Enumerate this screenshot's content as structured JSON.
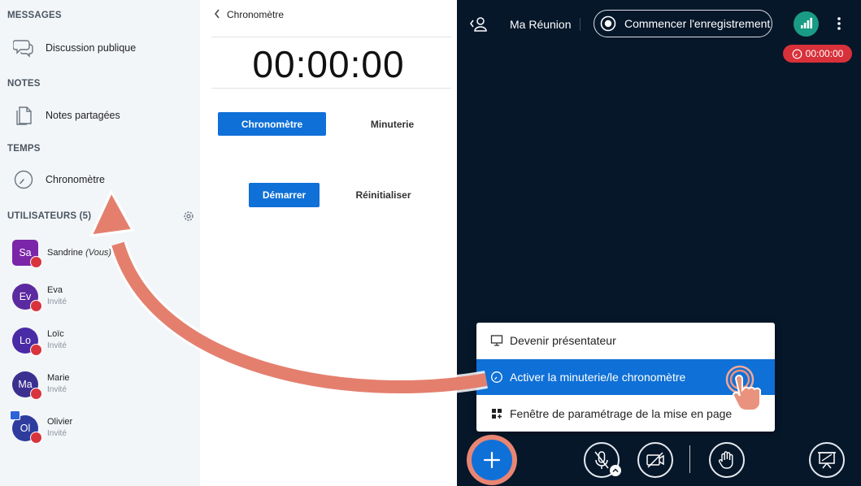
{
  "sidebar": {
    "messages_title": "MESSAGES",
    "public_chat": "Discussion publique",
    "notes_title": "NOTES",
    "shared_notes": "Notes partagées",
    "time_title": "TEMPS",
    "stopwatch": "Chronomètre",
    "users_title": "UTILISATEURS (5)",
    "users": [
      {
        "initials": "Sa",
        "name": "Sandrine",
        "you_tag": "(Vous)",
        "role": "",
        "color": "#7b25a8"
      },
      {
        "initials": "Ev",
        "name": "Eva",
        "you_tag": "",
        "role": "Invité",
        "color": "#5c2aa0"
      },
      {
        "initials": "Lo",
        "name": "Loïc",
        "you_tag": "",
        "role": "Invité",
        "color": "#4a2ba6"
      },
      {
        "initials": "Ma",
        "name": "Marie",
        "you_tag": "",
        "role": "Invité",
        "color": "#3b2f8f"
      },
      {
        "initials": "Ol",
        "name": "Olivier",
        "you_tag": "",
        "role": "Invité",
        "color": "#2e3c9e"
      }
    ]
  },
  "panel": {
    "title": "Chronomètre",
    "time": "00:00:00",
    "tab_stopwatch": "Chronomètre",
    "tab_timer": "Minuterie",
    "start": "Démarrer",
    "reset": "Réinitialiser"
  },
  "meeting": {
    "name": "Ma Réunion",
    "record": "Commencer l'enregistrement",
    "timer_badge": "00:00:00",
    "menu": {
      "become_presenter": "Devenir présentateur",
      "activate_timer": "Activer la minuterie/le chronomètre",
      "layout_settings": "Fenêtre de paramétrage de la mise en page"
    }
  },
  "colors": {
    "accent": "#0f70d7",
    "meeting_bg": "#06172a",
    "danger": "#d8313a",
    "annotation": "#e98573"
  }
}
